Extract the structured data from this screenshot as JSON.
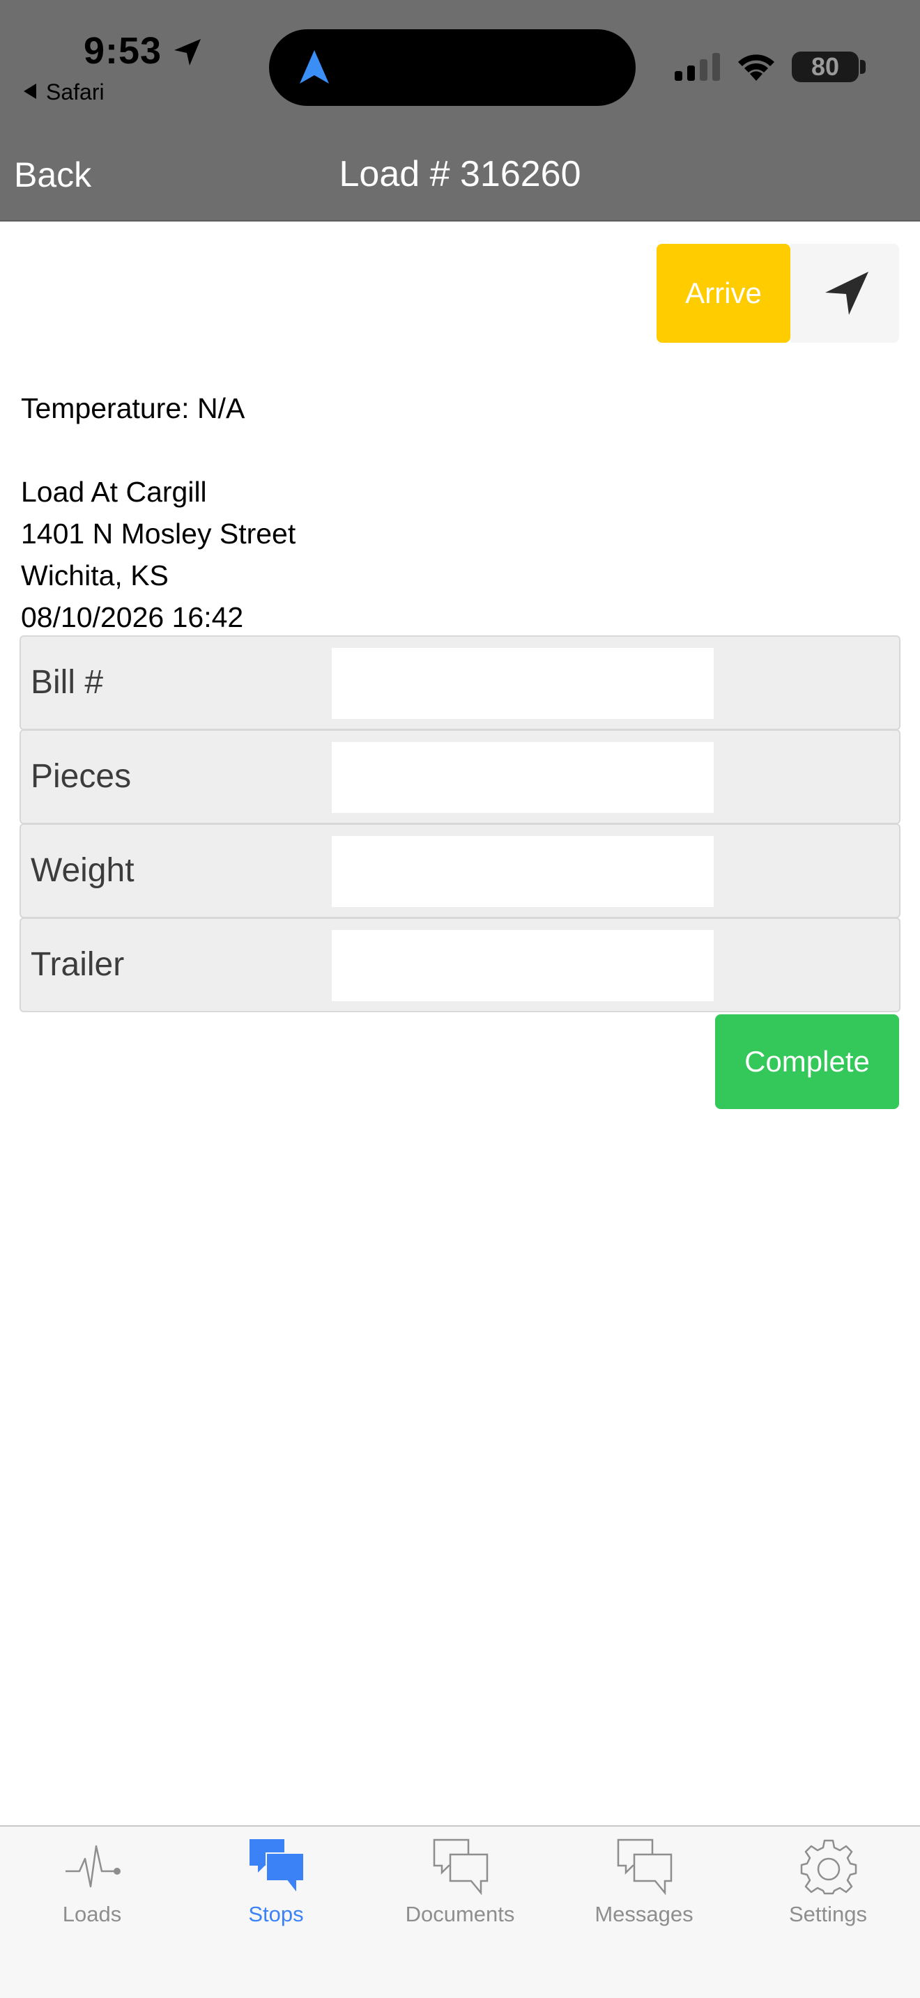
{
  "status_bar": {
    "time": "9:53",
    "back_app": "Safari",
    "battery": "80"
  },
  "nav": {
    "back_label": "Back",
    "title": "Load # 316260"
  },
  "actions": {
    "arrive_label": "Arrive",
    "complete_label": "Complete"
  },
  "stop": {
    "temperature": "Temperature: N/A",
    "location_name": "Load At Cargill",
    "street": "1401 N Mosley Street",
    "city_state": "Wichita, KS",
    "datetime": "08/10/2026 16:42"
  },
  "form": {
    "fields": [
      {
        "label": "Bill #",
        "value": ""
      },
      {
        "label": "Pieces",
        "value": ""
      },
      {
        "label": "Weight",
        "value": ""
      },
      {
        "label": "Trailer",
        "value": ""
      }
    ]
  },
  "tabs": [
    {
      "label": "Loads",
      "icon": "activity-icon"
    },
    {
      "label": "Stops",
      "icon": "chat-bubbles-icon"
    },
    {
      "label": "Documents",
      "icon": "chat-bubbles-icon"
    },
    {
      "label": "Messages",
      "icon": "chat-bubbles-icon"
    },
    {
      "label": "Settings",
      "icon": "gear-icon"
    }
  ],
  "active_tab": "Stops",
  "colors": {
    "header_bg": "#6e6e6e",
    "arrive": "#ffcc00",
    "complete": "#34c759",
    "active_tab": "#3b82f6",
    "inactive_tab": "#8e8e8e"
  }
}
